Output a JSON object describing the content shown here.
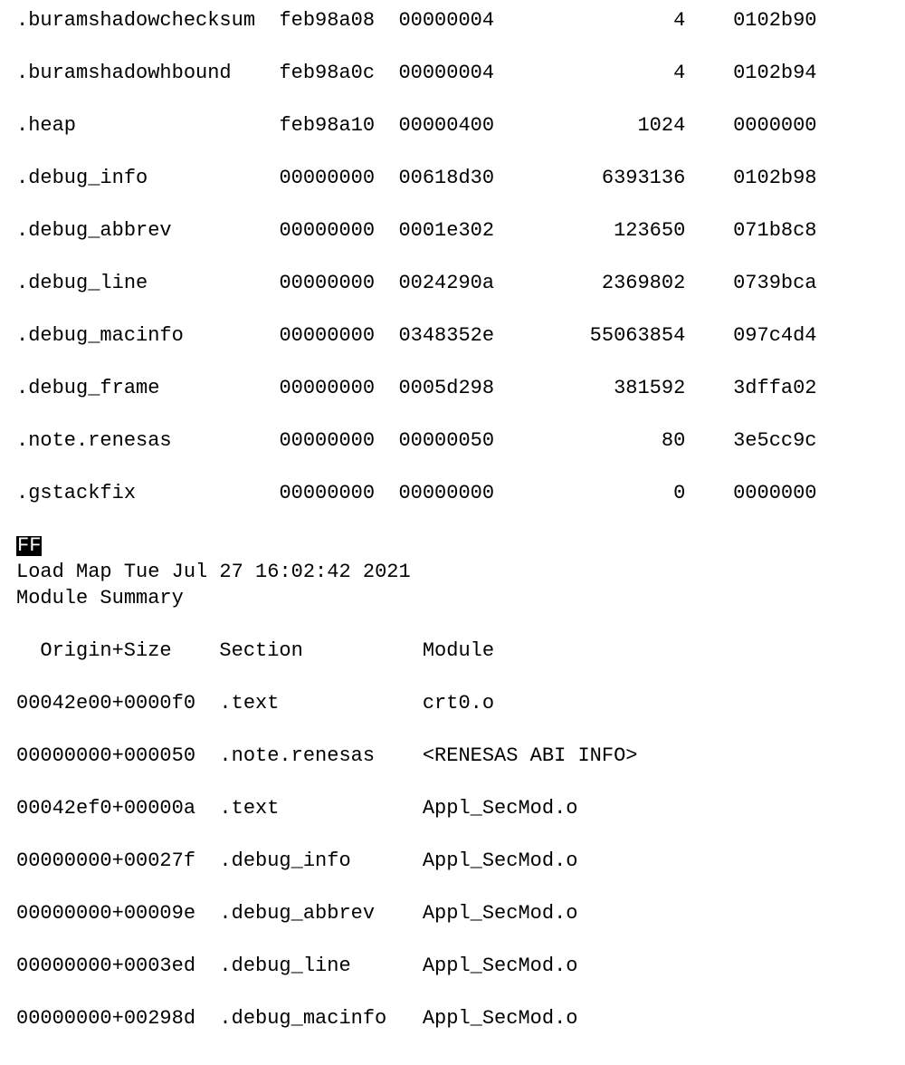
{
  "sections": [
    {
      "name": ".buramshadowchecksum",
      "a": "feb98a08",
      "b": "00000004",
      "dec": "4",
      "c": "0102b90"
    },
    {
      "name": ".buramshadowhbound",
      "a": "feb98a0c",
      "b": "00000004",
      "dec": "4",
      "c": "0102b94"
    },
    {
      "name": ".heap",
      "a": "feb98a10",
      "b": "00000400",
      "dec": "1024",
      "c": "0000000"
    },
    {
      "name": ".debug_info",
      "a": "00000000",
      "b": "00618d30",
      "dec": "6393136",
      "c": "0102b98"
    },
    {
      "name": ".debug_abbrev",
      "a": "00000000",
      "b": "0001e302",
      "dec": "123650",
      "c": "071b8c8"
    },
    {
      "name": ".debug_line",
      "a": "00000000",
      "b": "0024290a",
      "dec": "2369802",
      "c": "0739bca"
    },
    {
      "name": ".debug_macinfo",
      "a": "00000000",
      "b": "0348352e",
      "dec": "55063854",
      "c": "097c4d4"
    },
    {
      "name": ".debug_frame",
      "a": "00000000",
      "b": "0005d298",
      "dec": "381592",
      "c": "3dffa02"
    },
    {
      "name": ".note.renesas",
      "a": "00000000",
      "b": "00000050",
      "dec": "80",
      "c": "3e5cc9c"
    },
    {
      "name": ".gstackfix",
      "a": "00000000",
      "b": "00000000",
      "dec": "0",
      "c": "0000000"
    }
  ],
  "marker": "FF",
  "load_map_line": "Load Map Tue Jul 27 16:02:42 2021",
  "module_summary_label": "Module Summary",
  "module_header": {
    "origin_size": "Origin+Size",
    "section": "Section",
    "module": "Module"
  },
  "modules": [
    {
      "origin_size": "00042e00+0000f0",
      "section": ".text",
      "module": "crt0.o"
    },
    {
      "origin_size": "00000000+000050",
      "section": ".note.renesas",
      "module": "<RENESAS ABI INFO>"
    },
    {
      "origin_size": "00042ef0+00000a",
      "section": ".text",
      "module": "Appl_SecMod.o"
    },
    {
      "origin_size": "00000000+00027f",
      "section": ".debug_info",
      "module": "Appl_SecMod.o"
    },
    {
      "origin_size": "00000000+00009e",
      "section": ".debug_abbrev",
      "module": "Appl_SecMod.o"
    },
    {
      "origin_size": "00000000+0003ed",
      "section": ".debug_line",
      "module": "Appl_SecMod.o"
    },
    {
      "origin_size": "00000000+00298d",
      "section": ".debug_macinfo",
      "module": "Appl_SecMod.o"
    }
  ]
}
